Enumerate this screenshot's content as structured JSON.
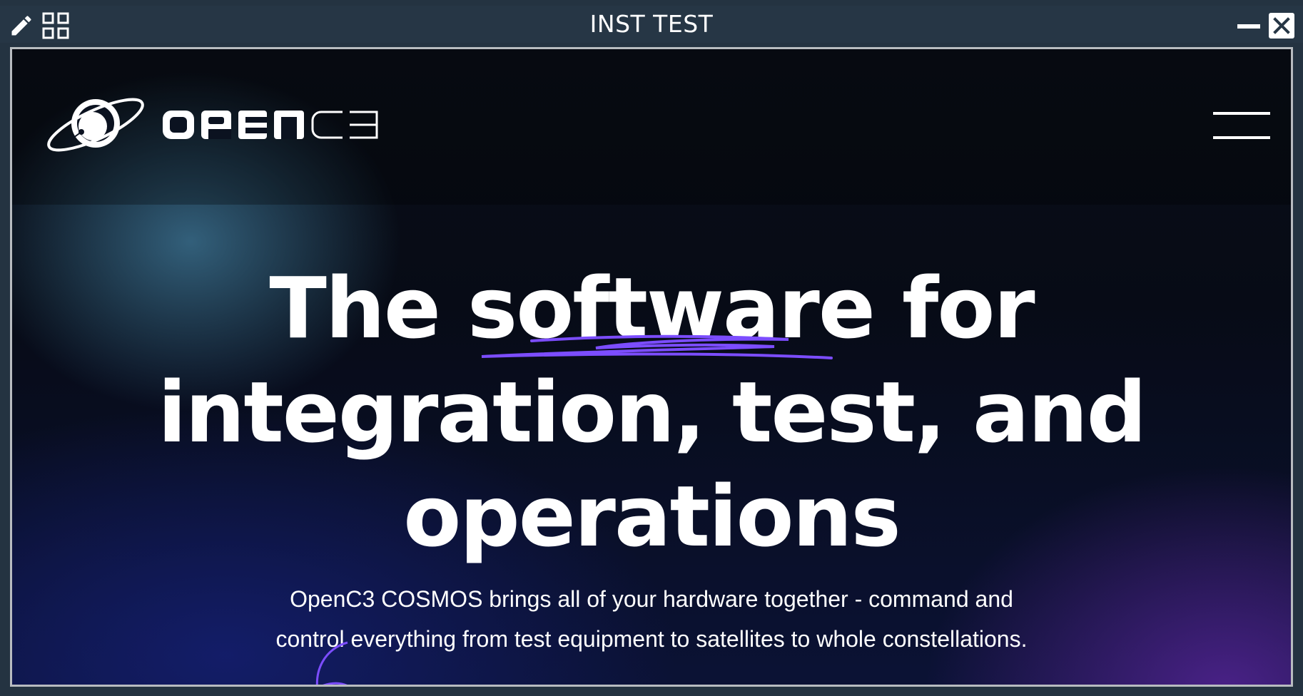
{
  "window": {
    "title": "INST TEST"
  },
  "icons": {
    "edit": "pencil-icon",
    "grid": "grid-icon",
    "minimize": "minimize-icon",
    "close": "close-icon",
    "menu": "hamburger-menu-icon"
  },
  "site": {
    "logo_text": "OPENC3",
    "hero": {
      "headline_line1": "The software for",
      "headline_line2": "integration, test, and",
      "headline_line3": "operations",
      "subtitle_line1": "OpenC3 COSMOS brings all of your hardware together - command and",
      "subtitle_line2": "control everything from test equipment to satellites to whole constellations."
    }
  },
  "colors": {
    "accent": "#7c4dff",
    "titlebar": "#263645",
    "text": "#ffffff"
  }
}
